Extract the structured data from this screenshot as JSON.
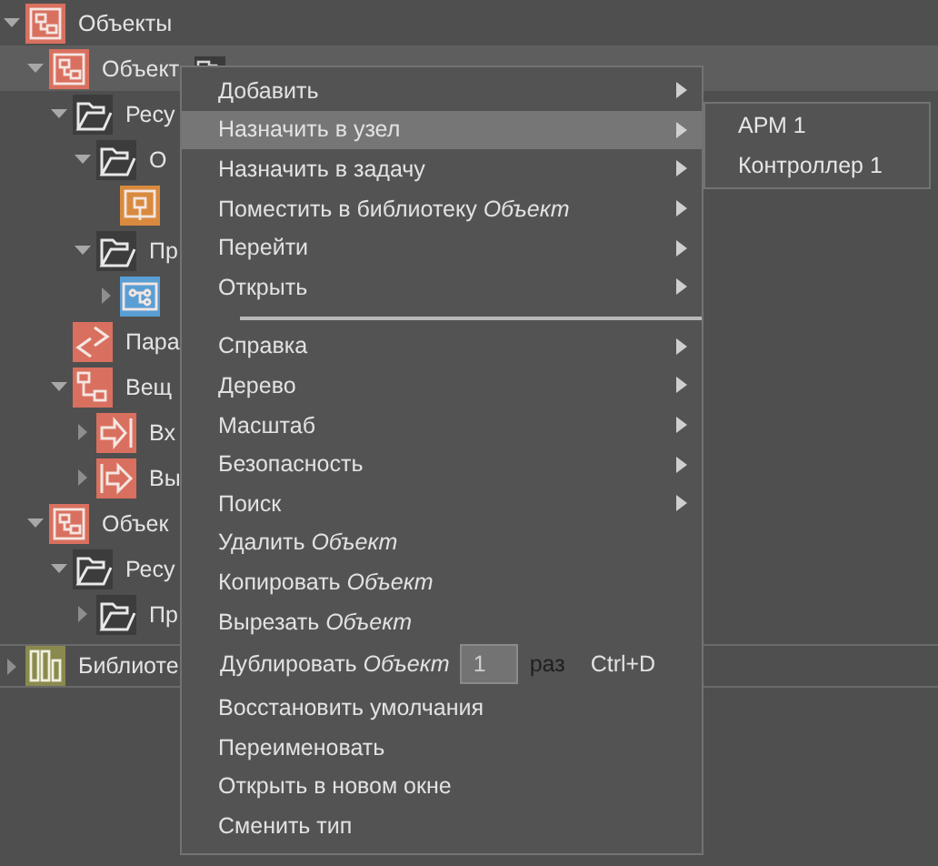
{
  "tree": [
    {
      "label": "Объекты",
      "kind": "object",
      "expanded": true,
      "selected": false,
      "children": [
        {
          "label": "Объект",
          "kind": "object",
          "expanded": true,
          "selected": true,
          "linked": true,
          "children": [
            {
              "label": "Ресу",
              "kind": "folder",
              "expanded": true,
              "selected": false,
              "children": [
                {
                  "label": "О",
                  "kind": "folder",
                  "expanded": true,
                  "selected": false,
                  "children": [
                    {
                      "kind": "block",
                      "selected": false
                    }
                  ]
                },
                {
                  "label": "Пр",
                  "kind": "folder",
                  "expanded": true,
                  "selected": false,
                  "children": [
                    {
                      "kind": "diagram",
                      "expanded": false,
                      "selected": false
                    }
                  ]
                }
              ]
            },
            {
              "label": "Пара",
              "kind": "params",
              "selected": false
            },
            {
              "label": "Вещ",
              "kind": "io",
              "expanded": true,
              "selected": false,
              "children": [
                {
                  "label": "Вх",
                  "kind": "input",
                  "expanded": false,
                  "selected": false
                },
                {
                  "label": "Вы",
                  "kind": "output",
                  "expanded": false,
                  "selected": false
                }
              ]
            }
          ]
        },
        {
          "label": "Объек",
          "kind": "object",
          "expanded": true,
          "selected": false,
          "children": [
            {
              "label": "Ресу",
              "kind": "folder",
              "expanded": true,
              "selected": false,
              "children": [
                {
                  "label": "Пр",
                  "kind": "folder",
                  "expanded": false,
                  "selected": false
                }
              ]
            }
          ]
        }
      ]
    }
  ],
  "library": {
    "label": "Библиоте",
    "kind": "library",
    "expanded": false
  },
  "context_menu": {
    "items": [
      {
        "kind": "submenu",
        "label": "Добавить",
        "selected": false
      },
      {
        "kind": "submenu",
        "label": "Назначить в узел",
        "selected": true
      },
      {
        "kind": "submenu",
        "label": "Назначить в задачу",
        "selected": false
      },
      {
        "kind": "submenu",
        "label": "Поместить в библиотеку *Объект*",
        "selected": false
      },
      {
        "kind": "submenu",
        "label": "Перейти",
        "selected": false
      },
      {
        "kind": "submenu",
        "label": "Открыть",
        "selected": false
      },
      {
        "kind": "separator"
      },
      {
        "kind": "submenu",
        "label": "Справка",
        "selected": false
      },
      {
        "kind": "submenu",
        "label": "Дерево",
        "selected": false
      },
      {
        "kind": "submenu",
        "label": "Масштаб",
        "selected": false
      },
      {
        "kind": "submenu",
        "label": "Безопасность",
        "selected": false
      },
      {
        "kind": "submenu",
        "label": "Поиск",
        "selected": false
      },
      {
        "kind": "action",
        "label": "Удалить *Объект*",
        "selected": false
      },
      {
        "kind": "action",
        "label": "Копировать *Объект*",
        "selected": false
      },
      {
        "kind": "action",
        "label": "Вырезать *Объект*",
        "selected": false
      },
      {
        "kind": "duplicate",
        "label": "Дублировать *Объект*",
        "value": "1",
        "suffix": "раз",
        "shortcut": "Ctrl+D",
        "selected": false
      },
      {
        "kind": "action",
        "label": "Восстановить умолчания",
        "selected": false
      },
      {
        "kind": "action",
        "label": "Переименовать",
        "selected": false
      },
      {
        "kind": "action",
        "label": "Открыть в новом окне",
        "selected": false
      },
      {
        "kind": "action",
        "label": "Сменить тип",
        "selected": false
      }
    ]
  },
  "submenu": {
    "items": [
      {
        "label": "АРМ 1"
      },
      {
        "label": "Контроллер 1"
      }
    ]
  }
}
